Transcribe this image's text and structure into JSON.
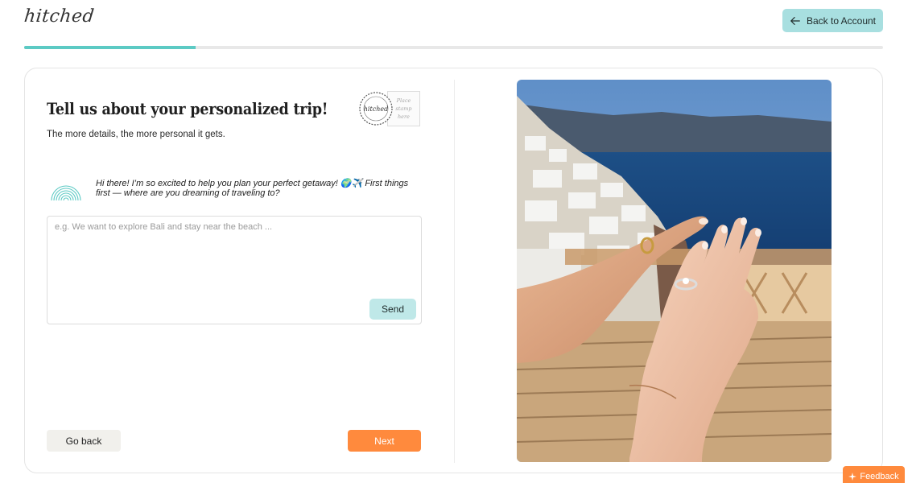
{
  "header": {
    "logo_text": "hitched",
    "back_button_label": "Back to Account"
  },
  "progress": {
    "value_percent": 20,
    "color": "#5ccac4"
  },
  "form": {
    "title": "Tell us about your personalized trip!",
    "subtitle": "The more details, the more personal it gets.",
    "stamp": {
      "postmark_text": "hitched",
      "box_text_line1": "Place",
      "box_text_line2": "stamp",
      "box_text_line3": "here"
    },
    "bot_message": "Hi there! I’m so excited to help you plan your perfect getaway! 🌍✈️ First things first — where are you dreaming of traveling to?",
    "input": {
      "placeholder": "e.g. We want to explore Bali and stay near the beach ...",
      "value": ""
    },
    "send_label": "Send",
    "go_back_label": "Go back",
    "next_label": "Next"
  },
  "feedback_label": "Feedback",
  "colors": {
    "accent_teal": "#a8dfe0",
    "accent_orange": "#ff8a3d"
  }
}
